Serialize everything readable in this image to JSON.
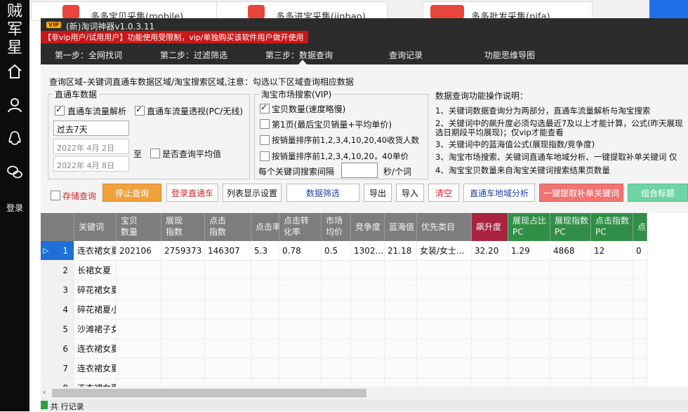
{
  "left_rail": {
    "logo_chars": "贼军星",
    "login": "登录"
  },
  "background": {
    "cards": [
      "多多宝贝采集(mobile)",
      "多多进宝采集(jinbao)",
      "多多批发采集(pifa)"
    ]
  },
  "window": {
    "vip_badge": "VIP",
    "title": "(新)淘词神器v1.0.3.11",
    "banner": "【非vip用户/试用用户】功能使用受限制，vip/单独购买该软件用户做开使用",
    "tabs": [
      "第一步：全网找词",
      "第二步：过滤筛选",
      "第三步：数据查询",
      "查询记录",
      "功能思维导图"
    ],
    "query_area_label": "查询区域–关键词直通车数据区域/淘宝搜索区域,注意：勾选以下区域查询相应数据"
  },
  "ztc": {
    "title": "直通车数据",
    "cb_flow": "直通车流量解析",
    "cb_visual": "直通车流量透视(PC/无线)",
    "period": "过去7天",
    "date_from": "2022年 4月 2日",
    "date_to": "2022年 4月 8日",
    "to_label": "至",
    "cb_avg": "是否查询平均值"
  },
  "taobao": {
    "title": "淘宝市场搜索(VIP)",
    "cb_count": "宝贝数量(速度略慢)",
    "cb_page1": "第1页(最后宝贝销量+平均单价)",
    "cb_sales_rank": "按销量排序前1,2,3,4,10,20,40收货人数",
    "cb_price_rank": "按销量排序前1,2,3,4,10,20，40单价",
    "interval_label": "每个关键词搜索间隔",
    "interval_unit": "秒/个词"
  },
  "help": {
    "title": "数据查询功能操作说明：",
    "lines": [
      "1、关键词数据查询分为两部分，直通车流量解析与淘宝搜索",
      "2、关键词中的飙升度必须勾选最近7及以上才能计算，公式(昨天展现",
      "选日期段平均展现)；仅vip才能查看",
      "3、关键词中的蓝海值公式(展现指数/竞争度)",
      "3、淘宝市场搜索、关键词直通车地域分析、一键提取补单关键词 仅",
      "4、淘宝宝贝数量来自淘宝关键词搜索结果页数量"
    ]
  },
  "toolbar": {
    "save_query": "存储查询",
    "stop": "停止查询",
    "login_ztc": "登录直通车",
    "col_settings": "列表显示设置",
    "filter": "数据筛选",
    "export": "导出",
    "import": "导入",
    "clear": "清空",
    "region": "直通车地域分析",
    "extract": "一键提取补单关键词",
    "combine": "组合标题"
  },
  "table": {
    "headers": [
      "关键词",
      "宝贝\n数量",
      "展现\n指数",
      "点击\n指数",
      "点击率",
      "点击转\n化率",
      "市场\n均价",
      "竞争度",
      "蓝海值",
      "优先类目",
      "飙升度",
      "展现占比\nPC",
      "展现指数\nPC",
      "点击指数\nPC",
      "点"
    ],
    "rows": [
      [
        "1",
        "连衣裙女夏季",
        "202106",
        "2759373",
        "146307",
        "5.3",
        "0.78",
        "0.5",
        "1302...",
        "21.18",
        "女装/女士...",
        "32.20",
        "1.29",
        "4868",
        "12",
        "0"
      ],
      [
        "2",
        "长裙女夏",
        "",
        "",
        "",
        "",
        "",
        "",
        "",
        "",
        "",
        "",
        "",
        "",
        "",
        ""
      ],
      [
        "3",
        "碎花裙女夏",
        "",
        "",
        "",
        "",
        "",
        "",
        "",
        "",
        "",
        "",
        "",
        "",
        "",
        ""
      ],
      [
        "4",
        "碎花裙夏小清新",
        "",
        "",
        "",
        "",
        "",
        "",
        "",
        "",
        "",
        "",
        "",
        "",
        "",
        ""
      ],
      [
        "5",
        "沙滩裙子女夏...",
        "",
        "",
        "",
        "",
        "",
        "",
        "",
        "",
        "",
        "",
        "",
        "",
        "",
        ""
      ],
      [
        "6",
        "连衣裙女夏季...",
        "",
        "",
        "",
        "",
        "",
        "",
        "",
        "",
        "",
        "",
        "",
        "",
        "",
        ""
      ],
      [
        "7",
        "连衣裙女夏季...",
        "",
        "",
        "",
        "",
        "",
        "",
        "",
        "",
        "",
        "",
        "",
        "",
        "",
        ""
      ],
      [
        "8",
        "连衣裙女夏季",
        "",
        "",
        "",
        "",
        "",
        "",
        "",
        "",
        "",
        "",
        "",
        "",
        "",
        ""
      ]
    ]
  },
  "status_text": "共 行记录",
  "colors": {
    "orange": "#f0a13c",
    "red_text": "#d22a2a",
    "blue_text": "#1f3ea8",
    "pink_btn": "#ef7472",
    "green_btn": "#6fd3a4",
    "header_red": "#a8243f",
    "header_green": "#2f8f46"
  }
}
